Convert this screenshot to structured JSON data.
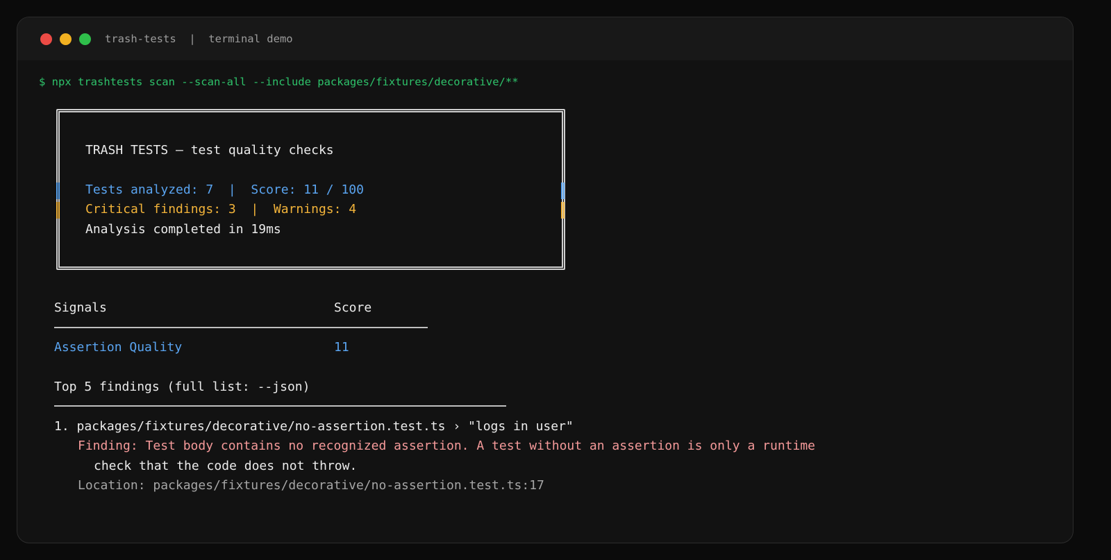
{
  "window": {
    "title": "trash-tests  |  terminal demo"
  },
  "terminal": {
    "command": "$ npx trashtests scan --scan-all --include packages/fixtures/decorative/**",
    "summary": {
      "heading": "TRASH TESTS — test quality checks",
      "stats_line": "Tests analyzed: 7  |  Score: 11 / 100",
      "findings_line": "Critical findings: 3  |  Warnings: 4",
      "timing_line": "Analysis completed in 19ms"
    },
    "signals": {
      "header_name": "Signals",
      "header_score": "Score",
      "rows": [
        {
          "name": "Assertion Quality",
          "score": "11"
        }
      ]
    },
    "findings": {
      "header": "Top 5 findings (full list: --json)",
      "items": [
        {
          "title": "1. packages/fixtures/decorative/no-assertion.test.ts › \"logs in user\"",
          "finding": "Finding: Test body contains no recognized assertion. A test without an assertion is only a runtime",
          "finding_cont": "check that the code does not throw.",
          "location": "Location: packages/fixtures/decorative/no-assertion.test.ts:17"
        }
      ]
    }
  },
  "colors": {
    "background": "#121212",
    "command": "#2ec26a",
    "accent_blue": "#5aa4f0",
    "warning_orange": "#f3b43a",
    "error_pink": "#f59a9a",
    "text": "#ececec",
    "muted": "#a6a6a6",
    "dot_close": "#ec4b45",
    "dot_minimize": "#f2b121",
    "dot_maximize": "#2fbf4b"
  }
}
